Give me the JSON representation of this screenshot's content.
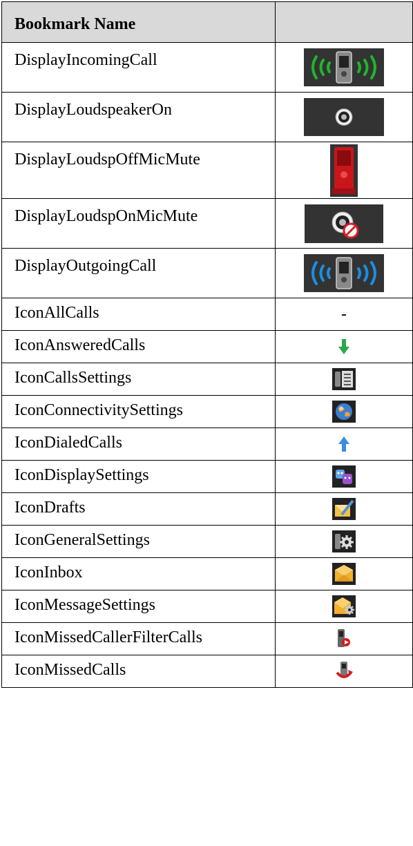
{
  "table": {
    "header": {
      "name": "Bookmark Name",
      "icon": ""
    },
    "rows": [
      {
        "name": "DisplayIncomingCall",
        "icon": "phone-ringing-green-icon"
      },
      {
        "name": "DisplayLoudspeakerOn",
        "icon": "loudspeaker-on-icon"
      },
      {
        "name": "DisplayLoudspOffMicMute",
        "icon": "red-phone-mic-mute-icon"
      },
      {
        "name": "DisplayLoudspOnMicMute",
        "icon": "loudspeaker-mic-mute-icon"
      },
      {
        "name": "DisplayOutgoingCall",
        "icon": "phone-ringing-blue-icon"
      },
      {
        "name": "IconAllCalls",
        "icon": "",
        "text": "-"
      },
      {
        "name": "IconAnsweredCalls",
        "icon": "green-down-arrow-icon"
      },
      {
        "name": "IconCallsSettings",
        "icon": "calls-settings-icon"
      },
      {
        "name": "IconConnectivitySettings",
        "icon": "globe-icon"
      },
      {
        "name": "IconDialedCalls",
        "icon": "blue-up-arrow-icon"
      },
      {
        "name": "IconDisplaySettings",
        "icon": "theater-masks-icon"
      },
      {
        "name": "IconDrafts",
        "icon": "drafts-pen-icon"
      },
      {
        "name": "IconGeneralSettings",
        "icon": "general-settings-gear-icon"
      },
      {
        "name": "IconInbox",
        "icon": "envelope-icon"
      },
      {
        "name": "IconMessageSettings",
        "icon": "envelope-gear-icon"
      },
      {
        "name": "IconMissedCallerFilterCalls",
        "icon": "missed-filter-phone-icon"
      },
      {
        "name": "IconMissedCalls",
        "icon": "missed-calls-icon"
      }
    ]
  },
  "colors": {
    "header_bg": "#d9d9d9",
    "display_icon_bg": "#333333",
    "incoming_waves": "#1fb52a",
    "outgoing_waves": "#1a8fe0",
    "phone_red": "#c8161b"
  }
}
